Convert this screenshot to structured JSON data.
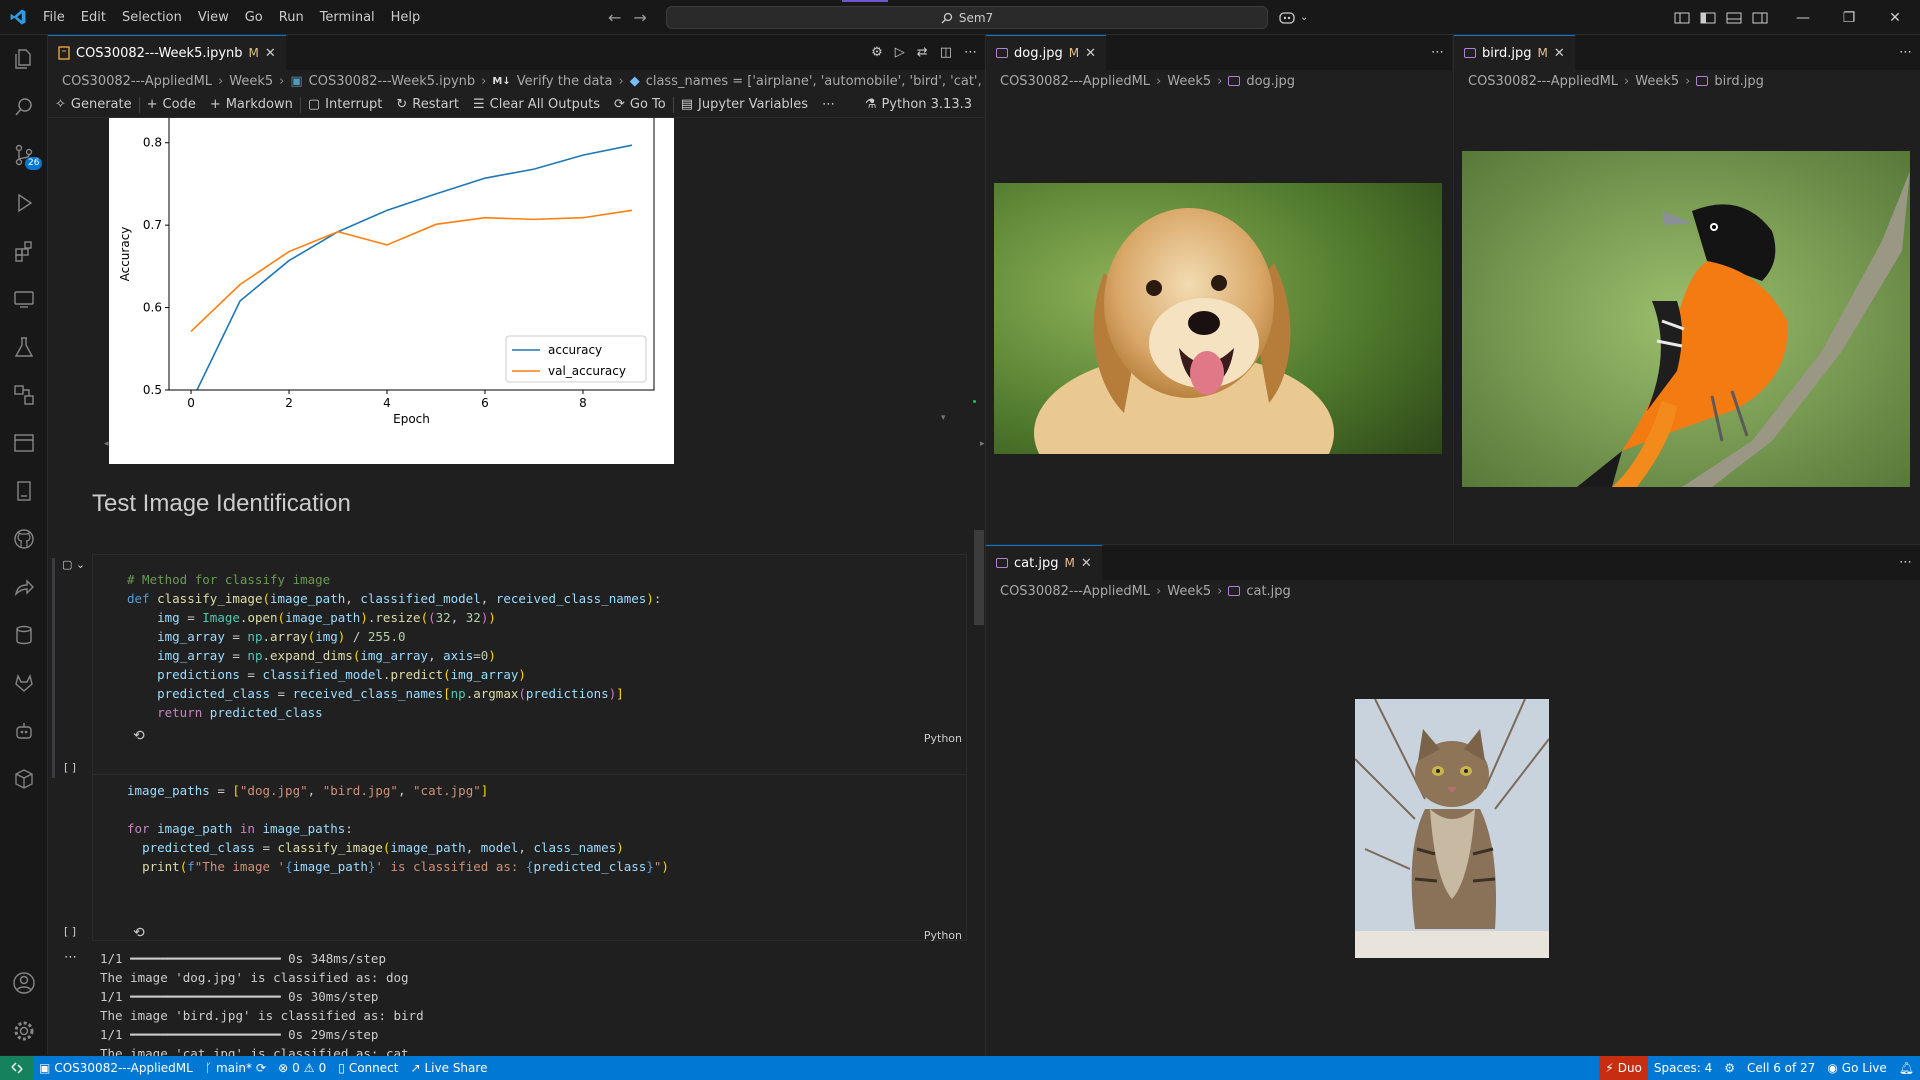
{
  "menu": [
    "File",
    "Edit",
    "Selection",
    "View",
    "Go",
    "Run",
    "Terminal",
    "Help"
  ],
  "command_center": "Sem7",
  "activity_badge": "26",
  "editor_left": {
    "tab": {
      "name": "COS30082---Week5.ipynb",
      "mod": "M"
    },
    "breadcrumb": [
      "COS30082---AppliedML",
      "Week5",
      "COS30082---Week5.ipynb",
      "Verify the data",
      "class_names = ['airplane', 'automobile', 'bird', 'cat', 'deer',"
    ],
    "toolbar": {
      "generate": "Generate",
      "code": "Code",
      "markdown": "Markdown",
      "interrupt": "Interrupt",
      "restart": "Restart",
      "clear": "Clear All Outputs",
      "goto": "Go To",
      "jupyter": "Jupyter Variables",
      "kernel": "Python 3.13.3"
    },
    "heading": "Test Image Identification",
    "cell1": {
      "lang": "Python",
      "exec": "[ ]"
    },
    "cell2": {
      "lang": "Python",
      "exec": "[ ]"
    },
    "output": [
      "1/1 ━━━━━━━━━━━━━━━━━━━━ 0s 348ms/step",
      "The image 'dog.jpg' is classified as: dog",
      "1/1 ━━━━━━━━━━━━━━━━━━━━ 0s 30ms/step",
      "The image 'bird.jpg' is classified as: bird",
      "1/1 ━━━━━━━━━━━━━━━━━━━━ 0s 29ms/step",
      "The image 'cat.jpg' is classified as: cat"
    ]
  },
  "chart_data": {
    "type": "line",
    "xlabel": "Epoch",
    "ylabel": "Accuracy",
    "xlim": [
      -0.45,
      9.45
    ],
    "ylim": [
      0.5,
      0.83
    ],
    "xticks": [
      "0",
      "2",
      "4",
      "6",
      "8"
    ],
    "yticks": [
      "0.5",
      "0.6",
      "0.7",
      "0.8"
    ],
    "legend_position": "lower-right",
    "x": [
      0,
      1,
      2,
      3,
      4,
      5,
      6,
      7,
      8,
      9
    ],
    "series": [
      {
        "name": "accuracy",
        "color": "#1f77b4",
        "values": [
          0.485,
          0.608,
          0.657,
          0.692,
          0.718,
          0.738,
          0.757,
          0.768,
          0.785,
          0.797
        ]
      },
      {
        "name": "val_accuracy",
        "color": "#ff7f0e",
        "values": [
          0.571,
          0.628,
          0.668,
          0.692,
          0.676,
          0.701,
          0.709,
          0.707,
          0.709,
          0.718
        ]
      }
    ]
  },
  "editor_dog": {
    "tab": {
      "name": "dog.jpg",
      "mod": "M"
    },
    "breadcrumb": [
      "COS30082---AppliedML",
      "Week5",
      "dog.jpg"
    ]
  },
  "editor_bird": {
    "tab": {
      "name": "bird.jpg",
      "mod": "M"
    },
    "breadcrumb": [
      "COS30082---AppliedML",
      "Week5",
      "bird.jpg"
    ]
  },
  "editor_cat": {
    "tab": {
      "name": "cat.jpg",
      "mod": "M"
    },
    "breadcrumb": [
      "COS30082---AppliedML",
      "Week5",
      "cat.jpg"
    ]
  },
  "status": {
    "remote": "COS30082---AppliedML",
    "branch": "main*",
    "problems": "0",
    "warnings": "0",
    "connect": "Connect",
    "liveshare": "Live Share",
    "duo": "Duo",
    "spaces": "Spaces: 4",
    "cell": "Cell 6 of 27",
    "golive": "Go Live"
  },
  "colors": {
    "accent": "#0078d4",
    "statusbar": "#0078d4",
    "duo": "#c72e0f",
    "remote": "#16825d"
  }
}
